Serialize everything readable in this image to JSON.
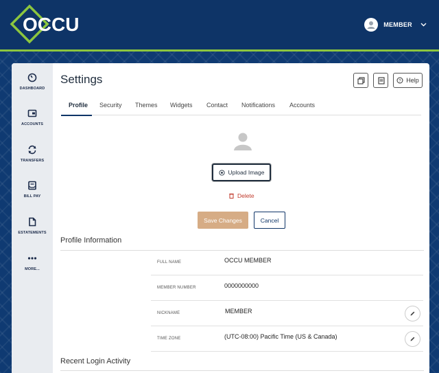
{
  "header": {
    "logo_text": "OCCU",
    "user_name": "MEMBER",
    "colors": {
      "navy": "#0e3467",
      "green": "#8cc63f"
    }
  },
  "sidenav": {
    "items": [
      {
        "label": "DASHBOARD",
        "icon": "gauge-icon"
      },
      {
        "label": "ACCOUNTS",
        "icon": "wallet-icon"
      },
      {
        "label": "TRANSFERS",
        "icon": "transfer-arrows-icon"
      },
      {
        "label": "BILL PAY",
        "icon": "bill-icon"
      },
      {
        "label": "ESTATEMENTS",
        "icon": "document-icon"
      },
      {
        "label": "MORE...",
        "icon": "more-dots-icon"
      }
    ]
  },
  "page": {
    "title": "Settings",
    "help_label": "Help"
  },
  "tabs": [
    {
      "label": "Profile",
      "active": true
    },
    {
      "label": "Security"
    },
    {
      "label": "Themes"
    },
    {
      "label": "Widgets"
    },
    {
      "label": "Contact"
    },
    {
      "label": "Notifications"
    },
    {
      "label": "Accounts"
    }
  ],
  "profile_photo": {
    "upload_label": "Upload Image",
    "delete_label": "Delete",
    "save_label": "Save Changes",
    "cancel_label": "Cancel"
  },
  "profile_information": {
    "title": "Profile Information",
    "rows": [
      {
        "label": "FULL NAME",
        "value": "OCCU  MEMBER",
        "editable": false
      },
      {
        "label": "MEMBER NUMBER",
        "value": "0000000000",
        "editable": false
      },
      {
        "label": "NICKNAME",
        "value": "MEMBER",
        "editable": true
      },
      {
        "label": "TIME ZONE",
        "value": "(UTC-08:00) Pacific Time (US & Canada)",
        "editable": true
      }
    ]
  },
  "recent_login": {
    "title": "Recent Login Activity"
  }
}
